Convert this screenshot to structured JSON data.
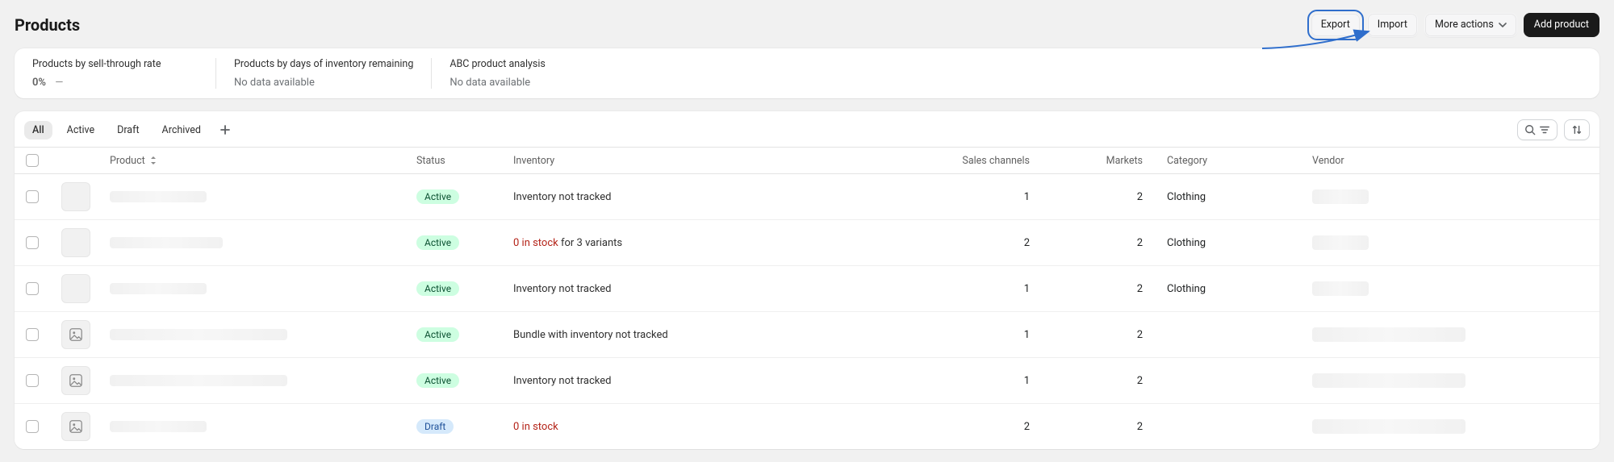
{
  "header": {
    "title": "Products",
    "export": "Export",
    "import": "Import",
    "more_actions": "More actions",
    "add_product": "Add product"
  },
  "metrics": [
    {
      "label": "Products by sell-through rate",
      "value": "0%",
      "sub": "—"
    },
    {
      "label": "Products by days of inventory remaining",
      "value": "No data available"
    },
    {
      "label": "ABC product analysis",
      "value": "No data available"
    }
  ],
  "tabs": {
    "items": [
      "All",
      "Active",
      "Draft",
      "Archived"
    ],
    "active_index": 0
  },
  "columns": {
    "product": "Product",
    "status": "Status",
    "inventory": "Inventory",
    "sales_channels": "Sales channels",
    "markets": "Markets",
    "category": "Category",
    "vendor": "Vendor"
  },
  "rows": [
    {
      "thumb_type": "blank",
      "name_width": "np1",
      "status": "Active",
      "status_variant": "active",
      "inventory_red": "",
      "inventory_rest": "Inventory not tracked",
      "sales_channels": "1",
      "markets": "2",
      "category": "Clothing",
      "vendor_width": "vp1"
    },
    {
      "thumb_type": "blank",
      "name_width": "np2",
      "status": "Active",
      "status_variant": "active",
      "inventory_red": "0 in stock",
      "inventory_rest": " for 3 variants",
      "sales_channels": "2",
      "markets": "2",
      "category": "Clothing",
      "vendor_width": "vp1"
    },
    {
      "thumb_type": "blank",
      "name_width": "np1",
      "status": "Active",
      "status_variant": "active",
      "inventory_red": "",
      "inventory_rest": "Inventory not tracked",
      "sales_channels": "1",
      "markets": "2",
      "category": "Clothing",
      "vendor_width": "vp1"
    },
    {
      "thumb_type": "icon",
      "name_width": "np3",
      "status": "Active",
      "status_variant": "active",
      "inventory_red": "",
      "inventory_rest": "Bundle with inventory not tracked",
      "sales_channels": "1",
      "markets": "2",
      "category": "",
      "vendor_width": "vp2"
    },
    {
      "thumb_type": "icon",
      "name_width": "np3",
      "status": "Active",
      "status_variant": "active",
      "inventory_red": "",
      "inventory_rest": "Inventory not tracked",
      "sales_channels": "1",
      "markets": "2",
      "category": "",
      "vendor_width": "vp2"
    },
    {
      "thumb_type": "icon",
      "name_width": "np1",
      "status": "Draft",
      "status_variant": "draft",
      "inventory_red": "0 in stock",
      "inventory_rest": "",
      "sales_channels": "2",
      "markets": "2",
      "category": "",
      "vendor_width": "vp2"
    }
  ]
}
